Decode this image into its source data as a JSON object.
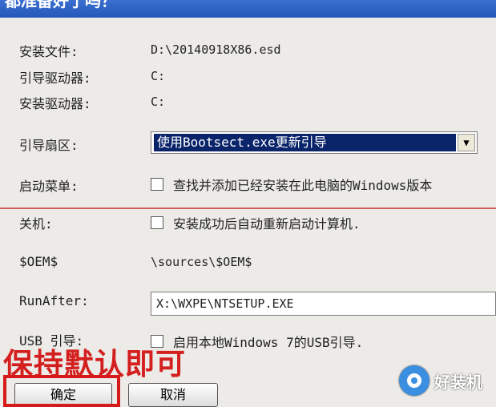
{
  "window": {
    "title": "都准备好了吗？"
  },
  "rows": {
    "install_file": {
      "label": "安装文件:",
      "value": "D:\\20140918X86.esd"
    },
    "boot_drive": {
      "label": "引导驱动器:",
      "value": "C:"
    },
    "install_drive": {
      "label": "安装驱动器:",
      "value": "C:"
    },
    "boot_sector": {
      "label": "引导扇区:",
      "selected": "使用Bootsect.exe更新引导"
    },
    "boot_menu": {
      "label": "启动菜单:",
      "checkbox_label": "查找并添加已经安装在此电脑的Windows版本",
      "checked": false
    },
    "shutdown": {
      "label": "关机:",
      "checkbox_label": "安装成功后自动重新启动计算机.",
      "checked": false
    },
    "oem": {
      "label": "$OEM$",
      "value": "\\sources\\$OEM$"
    },
    "run_after": {
      "label": "RunAfter:",
      "value": "X:\\WXPE\\NTSETUP.EXE"
    },
    "usb_boot": {
      "label": "USB 引导:",
      "checkbox_label": "启用本地Windows 7的USB引导.",
      "checked": false
    }
  },
  "annotation": {
    "note": "保持默认即可",
    "color": "#d41f1f"
  },
  "buttons": {
    "ok": "确定",
    "cancel": "取消"
  },
  "watermark": {
    "text": "好装机",
    "icon": "logo-icon"
  }
}
